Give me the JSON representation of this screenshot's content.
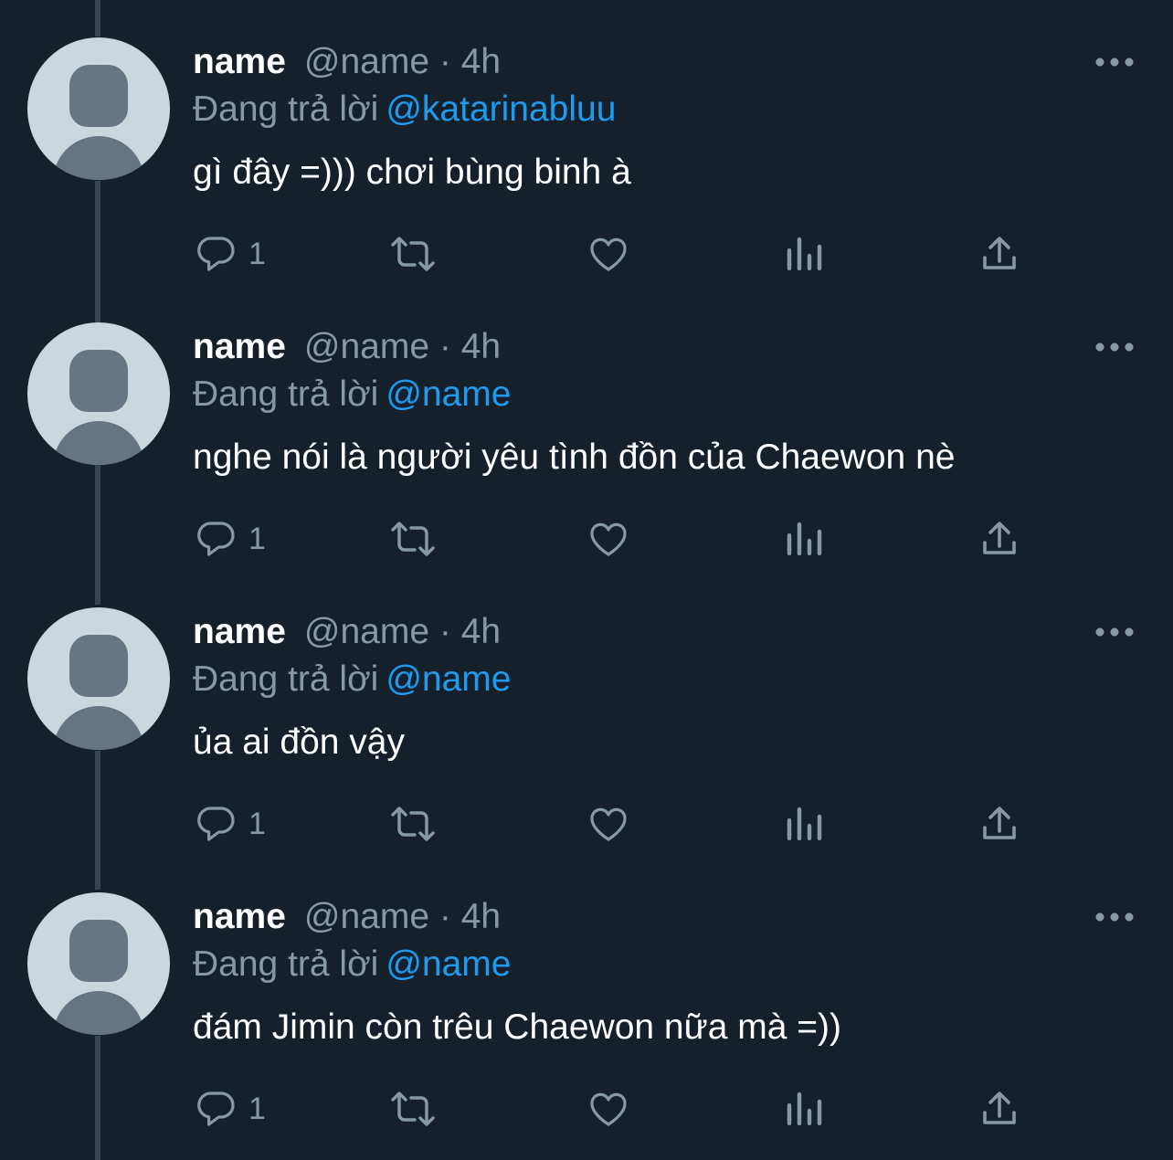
{
  "tweets": [
    {
      "display_name": "name",
      "handle": "@name",
      "time_sep": "·",
      "time": "4h",
      "reply_label": "Đang trả lời",
      "reply_to": "@katarinabluu",
      "text": "gì đây =))) chơi bùng binh à",
      "reply_count": "1"
    },
    {
      "display_name": "name",
      "handle": "@name",
      "time_sep": "·",
      "time": "4h",
      "reply_label": "Đang trả lời",
      "reply_to": "@name",
      "text": "nghe nói là người yêu tình đồn của Chaewon nè",
      "reply_count": "1"
    },
    {
      "display_name": "name",
      "handle": "@name",
      "time_sep": "·",
      "time": "4h",
      "reply_label": "Đang trả lời",
      "reply_to": "@name",
      "text": "ủa ai đồn vậy",
      "reply_count": "1"
    },
    {
      "display_name": "name",
      "handle": "@name",
      "time_sep": "·",
      "time": "4h",
      "reply_label": "Đang trả lời",
      "reply_to": "@name",
      "text": "đám Jimin còn trêu Chaewon nữa mà =))",
      "reply_count": "1"
    }
  ],
  "icons": {
    "reply": "reply-icon",
    "retweet": "retweet-icon",
    "like": "like-icon",
    "views": "views-icon",
    "share": "share-icon",
    "more": "more-icon"
  },
  "colors": {
    "background": "#15202b",
    "mention": "#1d9bf0",
    "secondary_text": "#8899a6",
    "thread_line": "#38444d"
  }
}
